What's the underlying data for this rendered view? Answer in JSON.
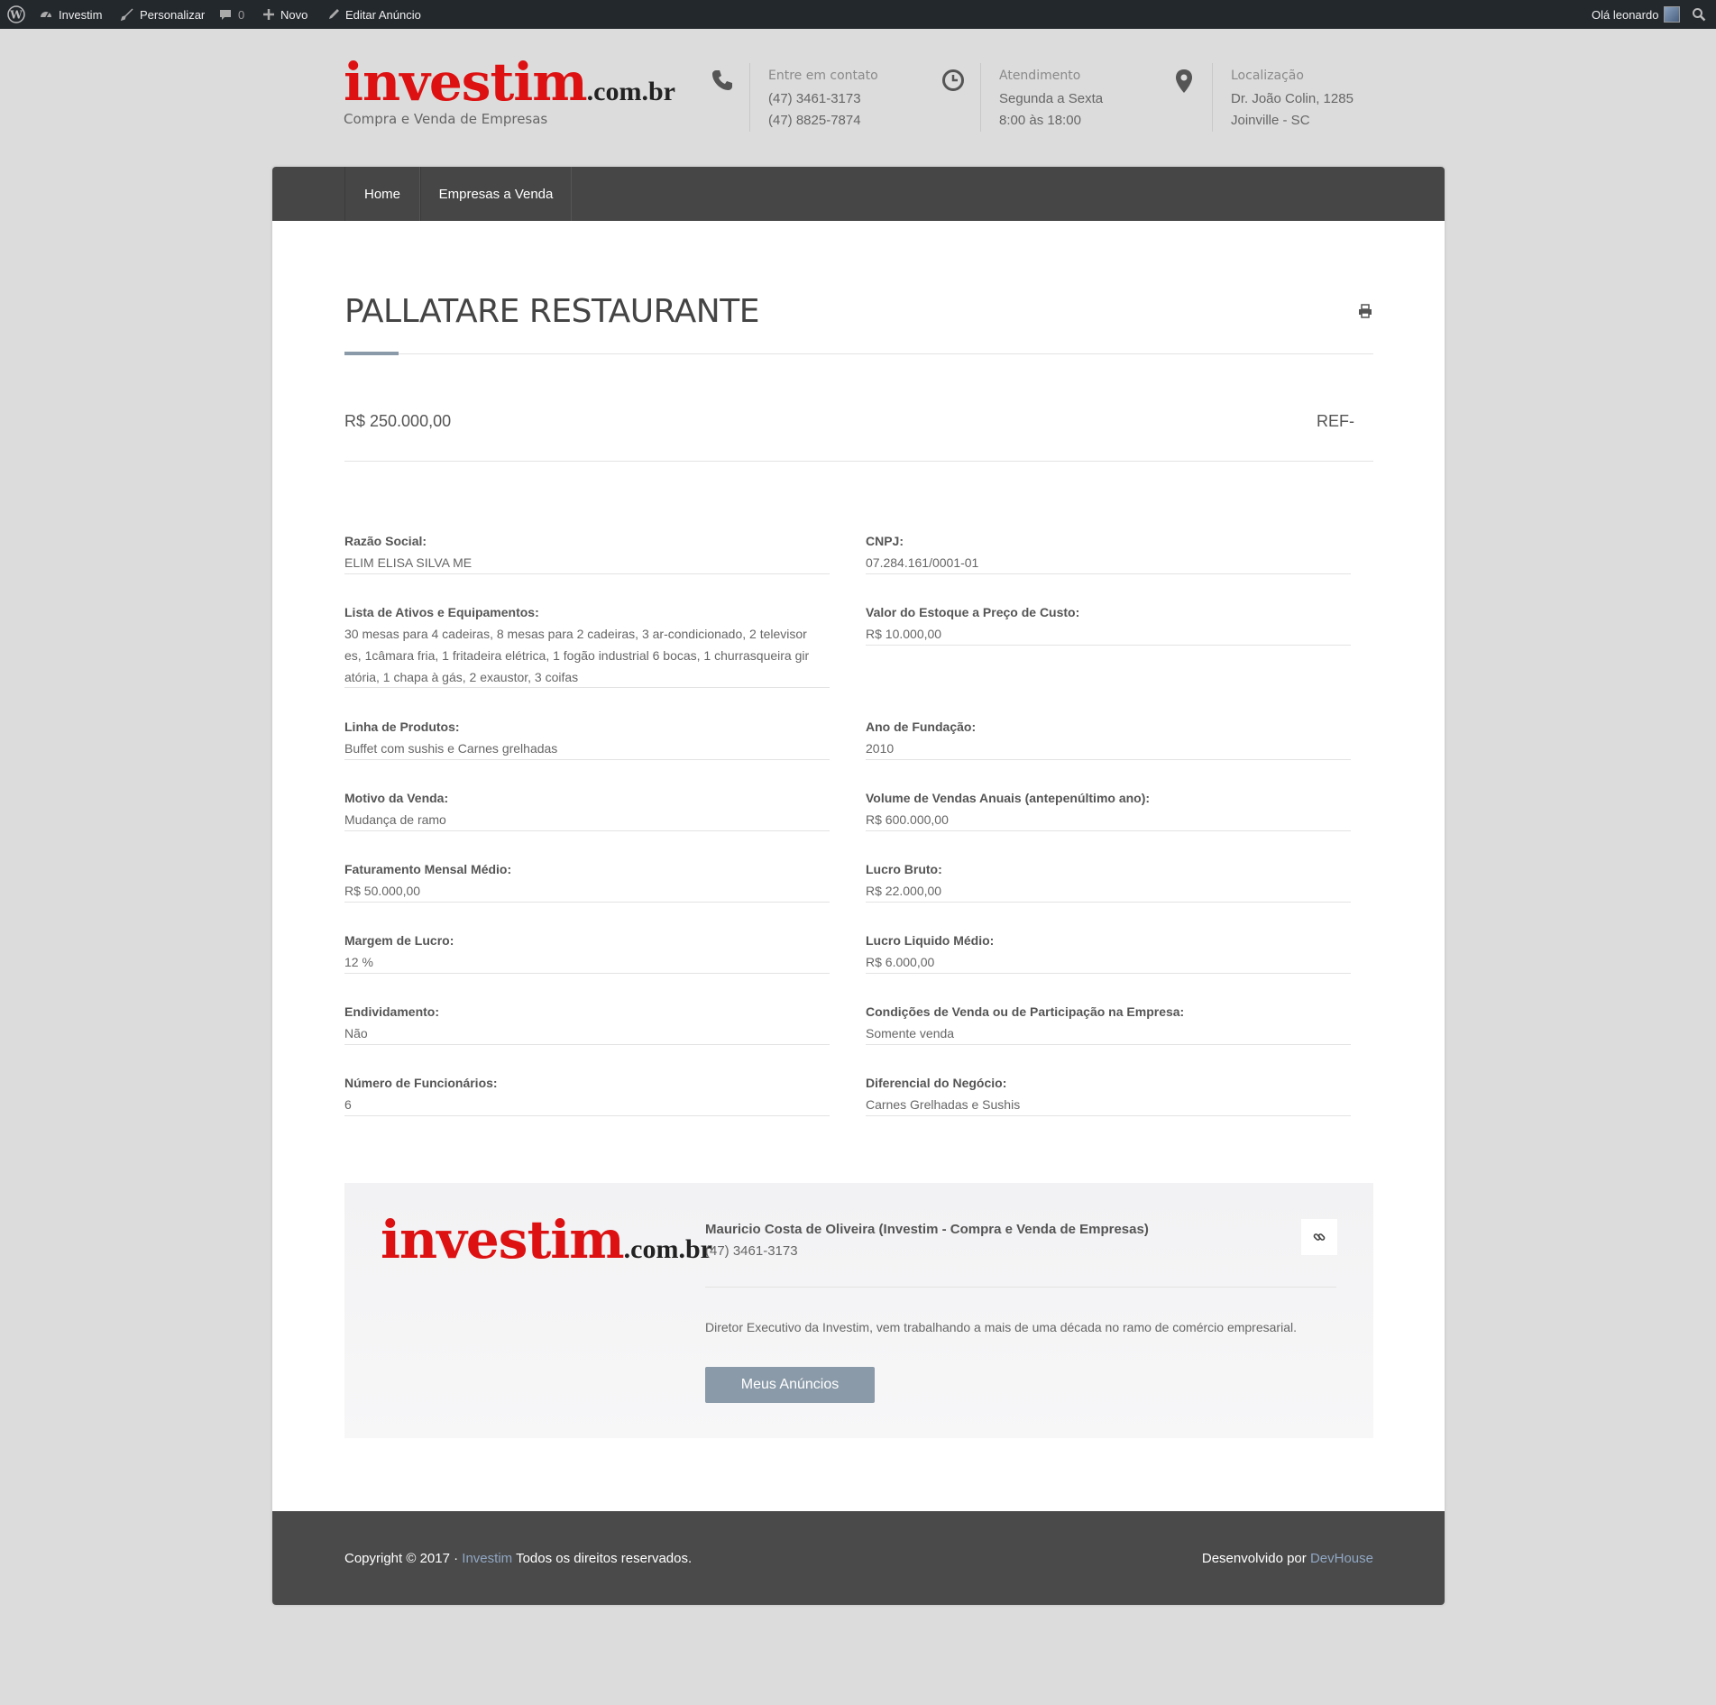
{
  "admin_bar": {
    "site_name": "Investim",
    "customize": "Personalizar",
    "comments_count": "0",
    "new": "Novo",
    "edit": "Editar Anúncio",
    "greeting": "Olá leonardo"
  },
  "header": {
    "logo_main": "investim",
    "logo_suffix": ".com.br",
    "tagline": "Compra e Venda de Empresas",
    "contact": {
      "label": "Entre em contato",
      "line1": "(47) 3461-3173",
      "line2": "(47) 8825-7874"
    },
    "hours": {
      "label": "Atendimento",
      "line1": "Segunda a Sexta",
      "line2": "8:00 às 18:00"
    },
    "location": {
      "label": "Localização",
      "line1": "Dr. João Colin, 1285",
      "line2": "Joinville - SC"
    }
  },
  "nav": {
    "items": [
      "Home",
      "Empresas a Venda"
    ]
  },
  "listing": {
    "title": "PALLATARE RESTAURANTE",
    "price": "R$ 250.000,00",
    "ref": "REF-",
    "fields_left": [
      {
        "label": "Razão Social:",
        "value": "ELIM ELISA SILVA ME"
      },
      {
        "label": "Lista de Ativos e Equipamentos:",
        "value_lines": [
          "30 mesas para 4 cadeiras, 8 mesas para 2 cadeiras, 3 ar-condicionado, 2 televisor",
          "es, 1câmara fria, 1 fritadeira elétrica, 1 fogão industrial 6 bocas, 1 churrasqueira gir",
          "atória, 1 chapa à gás, 2 exaustor, 3 coifas"
        ]
      },
      {
        "label": "Linha de Produtos:",
        "value": "Buffet com sushis e Carnes grelhadas"
      },
      {
        "label": "Motivo da Venda:",
        "value": "Mudança de ramo"
      },
      {
        "label": "Faturamento Mensal Médio:",
        "value": "R$ 50.000,00"
      },
      {
        "label": "Margem de Lucro:",
        "value": "12 %"
      },
      {
        "label": "Endividamento:",
        "value": "Não"
      },
      {
        "label": "Número de Funcionários:",
        "value": "6"
      }
    ],
    "fields_right": [
      {
        "label": "CNPJ:",
        "value": "07.284.161/0001-01"
      },
      {
        "label": "Valor do Estoque a Preço de Custo:",
        "value": "R$ 10.000,00"
      },
      {
        "label": "Ano de Fundação:",
        "value": "2010"
      },
      {
        "label": "Volume de Vendas Anuais (antepenúltimo ano):",
        "value": "R$ 600.000,00"
      },
      {
        "label": "Lucro Bruto:",
        "value": "R$ 22.000,00"
      },
      {
        "label": "Lucro Liquido Médio:",
        "value": "R$ 6.000,00"
      },
      {
        "label": "Condições de Venda ou de Participação na Empresa:",
        "value": "Somente venda"
      },
      {
        "label": "Diferencial do Negócio:",
        "value": "Carnes Grelhadas e Sushis"
      }
    ]
  },
  "author": {
    "name": "Mauricio Costa de Oliveira (Investim - Compra e Venda de Empresas)",
    "phone": "(47) 3461-3173",
    "description": "Diretor Executivo da Investim, vem trabalhando a mais de uma década no ramo de comércio empresarial.",
    "button": "Meus Anúncios"
  },
  "footer": {
    "copyright_prefix": "Copyright © 2017 ·",
    "copyright_link": "Investim",
    "copyright_suffix": "Todos os direitos reservados.",
    "dev_prefix": "Desenvolvido por",
    "dev_link": "DevHouse"
  }
}
